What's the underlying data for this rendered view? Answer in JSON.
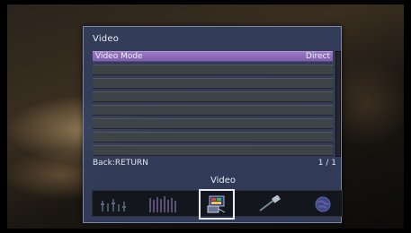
{
  "panel": {
    "title": "Video",
    "rows": [
      {
        "label": "Video Mode",
        "value": "Direct",
        "selected": true
      },
      {
        "label": "",
        "value": ""
      },
      {
        "label": "",
        "value": ""
      },
      {
        "label": "",
        "value": ""
      },
      {
        "label": "",
        "value": ""
      },
      {
        "label": "",
        "value": ""
      },
      {
        "label": "",
        "value": ""
      },
      {
        "label": "",
        "value": ""
      }
    ],
    "back_hint": "Back:RETURN",
    "page_indicator": "1 / 1"
  },
  "category_bar": {
    "selected_label": "Video",
    "icons": [
      "speaker-levels-icon",
      "equalizer-icon",
      "video-icon",
      "hdmi-cable-icon",
      "globe-icon"
    ]
  },
  "colors": {
    "panel_bg": "#343e5c",
    "selected_row": "#8a6bb8",
    "row_bg": "#3e4348"
  }
}
